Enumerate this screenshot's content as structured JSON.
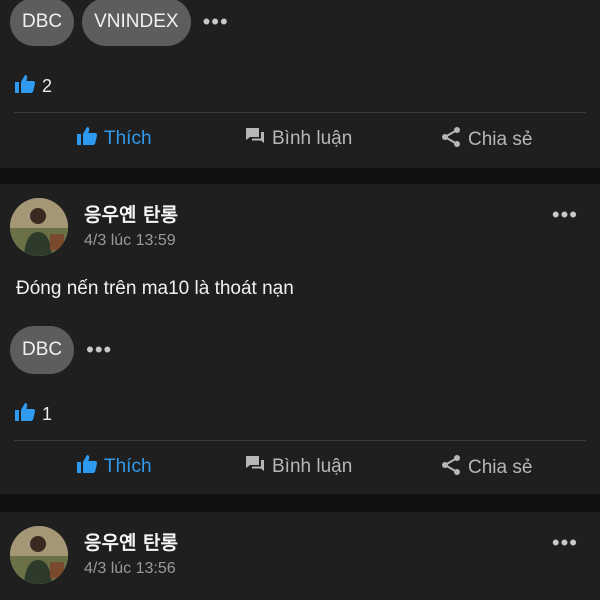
{
  "posts": [
    {
      "tags": [
        "DBC",
        "VNINDEX"
      ],
      "likes": "2",
      "actions": {
        "like": "Thích",
        "comment": "Bình luận",
        "share": "Chia sẻ"
      }
    },
    {
      "author": "응우옌 탄롱",
      "time": "4/3 lúc 13:59",
      "text": "Đóng nến trên ma10 là thoát nạn",
      "tags": [
        "DBC"
      ],
      "likes": "1",
      "actions": {
        "like": "Thích",
        "comment": "Bình luận",
        "share": "Chia sẻ"
      }
    },
    {
      "author": "응우옌 탄롱",
      "time": "4/3 lúc 13:56"
    }
  ],
  "colors": {
    "accent": "#2f9bf0",
    "background": "#111111",
    "card": "#1f1f1f",
    "tag": "#5d5d5d"
  }
}
